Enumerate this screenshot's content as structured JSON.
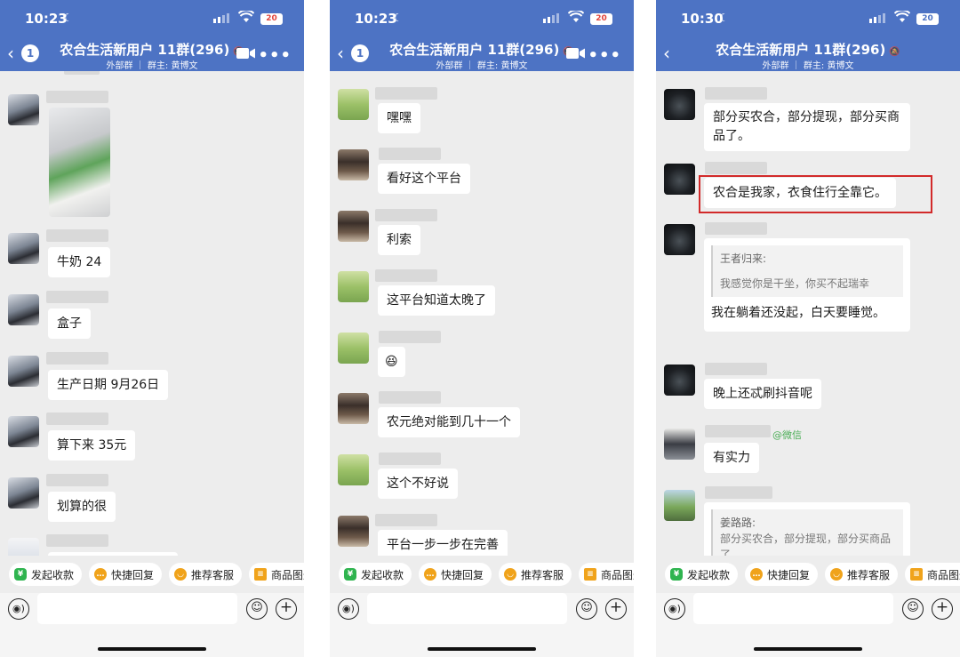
{
  "colors": {
    "header": "#4d73c4",
    "highlight": "#d22a2a",
    "wechat_green": "#4cae57"
  },
  "screens": [
    {
      "status_time": "10:23",
      "battery": "20",
      "battery_low": true,
      "unread": "1",
      "title": "农合生活新用户 11群(296)",
      "subtitle": "外部群 ｜ 群主: 黄博文",
      "messages": [
        {
          "text": "牛奶 24"
        },
        {
          "text": "盒子"
        },
        {
          "text": "生产日期 9月26日"
        },
        {
          "text": "算下来 35元"
        },
        {
          "text": "划算的很"
        }
      ]
    },
    {
      "status_time": "10:23",
      "battery": "20",
      "battery_low": true,
      "unread": "1",
      "title": "农合生活新用户 11群(296)",
      "subtitle": "外部群 ｜ 群主: 黄博文",
      "messages": [
        {
          "text": "嘿嘿"
        },
        {
          "text": "看好这个平台"
        },
        {
          "text": "利索"
        },
        {
          "text": "这平台知道太晚了"
        },
        {
          "text": "😆"
        },
        {
          "text": "农元绝对能到几十一个"
        },
        {
          "text": "这个不好说"
        },
        {
          "text": "平台一步一步在完善"
        }
      ]
    },
    {
      "status_time": "10:30",
      "battery": "20",
      "battery_low": false,
      "title": "农合生活新用户 11群(296)",
      "subtitle": "外部群 ｜ 群主: 黄博文",
      "messages": [
        {
          "text": "部分买农合，部分提现，部分买商品了。"
        },
        {
          "text": "农合是我家，衣食住行全靠它。"
        },
        {
          "quote_name": "王者归来:",
          "quote_text": "我感觉你是干坐，你买不起瑞幸",
          "text": "我在躺着还没起，白天要睡觉。"
        },
        {
          "text": "晚上还忒刷抖音呢"
        },
        {
          "tag": "@微信",
          "text": "有实力"
        },
        {
          "quote_name": "姜路路:",
          "quote_text": "部分买农合，部分提现，部分买商品了。"
        }
      ]
    }
  ],
  "quick_actions": [
    {
      "label": "发起收款",
      "icon": "yuan-icon"
    },
    {
      "label": "快捷回复",
      "icon": "reply-icon"
    },
    {
      "label": "推荐客服",
      "icon": "service-icon"
    },
    {
      "label": "商品图册",
      "icon": "catalog-icon"
    }
  ]
}
